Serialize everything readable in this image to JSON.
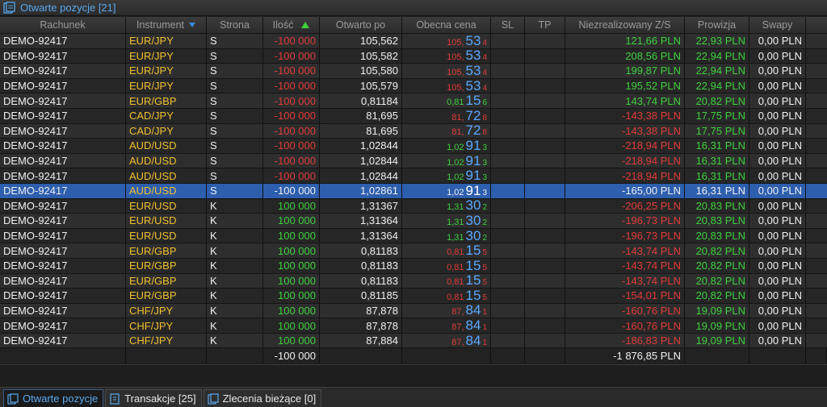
{
  "window": {
    "title": "Otwarte pozycje [21]"
  },
  "columns": [
    "Rachunek",
    "Instrument",
    "Strona",
    "Ilość",
    "Otwarto po",
    "Obecna cena",
    "SL",
    "TP",
    "Niezrealizowany Z/S",
    "Prowizja",
    "Swapy"
  ],
  "rows": [
    {
      "account": "DEMO-92417",
      "instrument": "EUR/JPY",
      "side": "S",
      "qty": "-100 000",
      "open": "105,562",
      "cur_base": "105,",
      "cur_big": "53",
      "cur_pip": "4",
      "cur_dir": "red",
      "pl": "121,66 PLN",
      "pl_dir": "green",
      "comm": "22,93 PLN",
      "swap": "0,00 PLN"
    },
    {
      "account": "DEMO-92417",
      "instrument": "EUR/JPY",
      "side": "S",
      "qty": "-100 000",
      "open": "105,582",
      "cur_base": "105,",
      "cur_big": "53",
      "cur_pip": "4",
      "cur_dir": "red",
      "pl": "208,56 PLN",
      "pl_dir": "green",
      "comm": "22,94 PLN",
      "swap": "0,00 PLN"
    },
    {
      "account": "DEMO-92417",
      "instrument": "EUR/JPY",
      "side": "S",
      "qty": "-100 000",
      "open": "105,580",
      "cur_base": "105,",
      "cur_big": "53",
      "cur_pip": "4",
      "cur_dir": "red",
      "pl": "199,87 PLN",
      "pl_dir": "green",
      "comm": "22,94 PLN",
      "swap": "0,00 PLN"
    },
    {
      "account": "DEMO-92417",
      "instrument": "EUR/JPY",
      "side": "S",
      "qty": "-100 000",
      "open": "105,579",
      "cur_base": "105,",
      "cur_big": "53",
      "cur_pip": "4",
      "cur_dir": "red",
      "pl": "195,52 PLN",
      "pl_dir": "green",
      "comm": "22,94 PLN",
      "swap": "0,00 PLN"
    },
    {
      "account": "DEMO-92417",
      "instrument": "EUR/GBP",
      "side": "S",
      "qty": "-100 000",
      "open": "0,81184",
      "cur_base": "0,81",
      "cur_big": "15",
      "cur_pip": "6",
      "cur_dir": "green",
      "pl": "143,74 PLN",
      "pl_dir": "green",
      "comm": "20,82 PLN",
      "swap": "0,00 PLN"
    },
    {
      "account": "DEMO-92417",
      "instrument": "CAD/JPY",
      "side": "S",
      "qty": "-100 000",
      "open": "81,695",
      "cur_base": "81,",
      "cur_big": "72",
      "cur_pip": "8",
      "cur_dir": "red",
      "pl": "-143,38 PLN",
      "pl_dir": "red",
      "comm": "17,75 PLN",
      "swap": "0,00 PLN"
    },
    {
      "account": "DEMO-92417",
      "instrument": "CAD/JPY",
      "side": "S",
      "qty": "-100 000",
      "open": "81,695",
      "cur_base": "81,",
      "cur_big": "72",
      "cur_pip": "8",
      "cur_dir": "red",
      "pl": "-143,38 PLN",
      "pl_dir": "red",
      "comm": "17,75 PLN",
      "swap": "0,00 PLN"
    },
    {
      "account": "DEMO-92417",
      "instrument": "AUD/USD",
      "side": "S",
      "qty": "-100 000",
      "open": "1,02844",
      "cur_base": "1,02",
      "cur_big": "91",
      "cur_pip": "3",
      "cur_dir": "green",
      "pl": "-218,94 PLN",
      "pl_dir": "red",
      "comm": "16,31 PLN",
      "swap": "0,00 PLN"
    },
    {
      "account": "DEMO-92417",
      "instrument": "AUD/USD",
      "side": "S",
      "qty": "-100 000",
      "open": "1,02844",
      "cur_base": "1,02",
      "cur_big": "91",
      "cur_pip": "3",
      "cur_dir": "green",
      "pl": "-218,94 PLN",
      "pl_dir": "red",
      "comm": "16,31 PLN",
      "swap": "0,00 PLN"
    },
    {
      "account": "DEMO-92417",
      "instrument": "AUD/USD",
      "side": "S",
      "qty": "-100 000",
      "open": "1,02844",
      "cur_base": "1,02",
      "cur_big": "91",
      "cur_pip": "3",
      "cur_dir": "green",
      "pl": "-218,94 PLN",
      "pl_dir": "red",
      "comm": "16,31 PLN",
      "swap": "0,00 PLN"
    },
    {
      "account": "DEMO-92417",
      "instrument": "AUD/USD",
      "side": "S",
      "qty": "-100 000",
      "open": "1,02861",
      "cur_base": "1,02",
      "cur_big": "91",
      "cur_pip": "3",
      "cur_dir": "green",
      "pl": "-165,00 PLN",
      "pl_dir": "red",
      "comm": "16,31 PLN",
      "swap": "0,00 PLN",
      "selected": true
    },
    {
      "account": "DEMO-92417",
      "instrument": "EUR/USD",
      "side": "K",
      "qty": "100 000",
      "open": "1,31367",
      "cur_base": "1,31",
      "cur_big": "30",
      "cur_pip": "2",
      "cur_dir": "green",
      "pl": "-206,25 PLN",
      "pl_dir": "red",
      "comm": "20,83 PLN",
      "swap": "0,00 PLN"
    },
    {
      "account": "DEMO-92417",
      "instrument": "EUR/USD",
      "side": "K",
      "qty": "100 000",
      "open": "1,31364",
      "cur_base": "1,31",
      "cur_big": "30",
      "cur_pip": "2",
      "cur_dir": "green",
      "pl": "-196,73 PLN",
      "pl_dir": "red",
      "comm": "20,83 PLN",
      "swap": "0,00 PLN"
    },
    {
      "account": "DEMO-92417",
      "instrument": "EUR/USD",
      "side": "K",
      "qty": "100 000",
      "open": "1,31364",
      "cur_base": "1,31",
      "cur_big": "30",
      "cur_pip": "2",
      "cur_dir": "green",
      "pl": "-196,73 PLN",
      "pl_dir": "red",
      "comm": "20,83 PLN",
      "swap": "0,00 PLN"
    },
    {
      "account": "DEMO-92417",
      "instrument": "EUR/GBP",
      "side": "K",
      "qty": "100 000",
      "open": "0,81183",
      "cur_base": "0,81",
      "cur_big": "15",
      "cur_pip": "5",
      "cur_dir": "red",
      "pl": "-143,74 PLN",
      "pl_dir": "red",
      "comm": "20,82 PLN",
      "swap": "0,00 PLN"
    },
    {
      "account": "DEMO-92417",
      "instrument": "EUR/GBP",
      "side": "K",
      "qty": "100 000",
      "open": "0,81183",
      "cur_base": "0,81",
      "cur_big": "15",
      "cur_pip": "5",
      "cur_dir": "red",
      "pl": "-143,74 PLN",
      "pl_dir": "red",
      "comm": "20,82 PLN",
      "swap": "0,00 PLN"
    },
    {
      "account": "DEMO-92417",
      "instrument": "EUR/GBP",
      "side": "K",
      "qty": "100 000",
      "open": "0,81183",
      "cur_base": "0,81",
      "cur_big": "15",
      "cur_pip": "5",
      "cur_dir": "red",
      "pl": "-143,74 PLN",
      "pl_dir": "red",
      "comm": "20,82 PLN",
      "swap": "0,00 PLN"
    },
    {
      "account": "DEMO-92417",
      "instrument": "EUR/GBP",
      "side": "K",
      "qty": "100 000",
      "open": "0,81185",
      "cur_base": "0,81",
      "cur_big": "15",
      "cur_pip": "5",
      "cur_dir": "red",
      "pl": "-154,01 PLN",
      "pl_dir": "red",
      "comm": "20,82 PLN",
      "swap": "0,00 PLN"
    },
    {
      "account": "DEMO-92417",
      "instrument": "CHF/JPY",
      "side": "K",
      "qty": "100 000",
      "open": "87,878",
      "cur_base": "87,",
      "cur_big": "84",
      "cur_pip": "1",
      "cur_dir": "red",
      "pl": "-160,76 PLN",
      "pl_dir": "red",
      "comm": "19,09 PLN",
      "swap": "0,00 PLN"
    },
    {
      "account": "DEMO-92417",
      "instrument": "CHF/JPY",
      "side": "K",
      "qty": "100 000",
      "open": "87,878",
      "cur_base": "87,",
      "cur_big": "84",
      "cur_pip": "1",
      "cur_dir": "red",
      "pl": "-160,76 PLN",
      "pl_dir": "red",
      "comm": "19,09 PLN",
      "swap": "0,00 PLN"
    },
    {
      "account": "DEMO-92417",
      "instrument": "CHF/JPY",
      "side": "K",
      "qty": "100 000",
      "open": "87,884",
      "cur_base": "87,",
      "cur_big": "84",
      "cur_pip": "1",
      "cur_dir": "red",
      "pl": "-186,83 PLN",
      "pl_dir": "red",
      "comm": "19,09 PLN",
      "swap": "0,00 PLN"
    }
  ],
  "totals": {
    "qty": "-100 000",
    "pl": "-1 876,85 PLN"
  },
  "tabs": [
    {
      "label": "Otwarte pozycje",
      "icon": "positions-icon",
      "active": true
    },
    {
      "label": "Transakcje [25]",
      "icon": "transactions-icon",
      "active": false
    },
    {
      "label": "Zlecenia bieżące [0]",
      "icon": "orders-icon",
      "active": false
    }
  ],
  "colors": {
    "accent": "#5aaaf0",
    "selected_row": "#2d5fae",
    "profit": "#3ed13e",
    "loss": "#e23a3a",
    "instrument": "#f0c030"
  }
}
